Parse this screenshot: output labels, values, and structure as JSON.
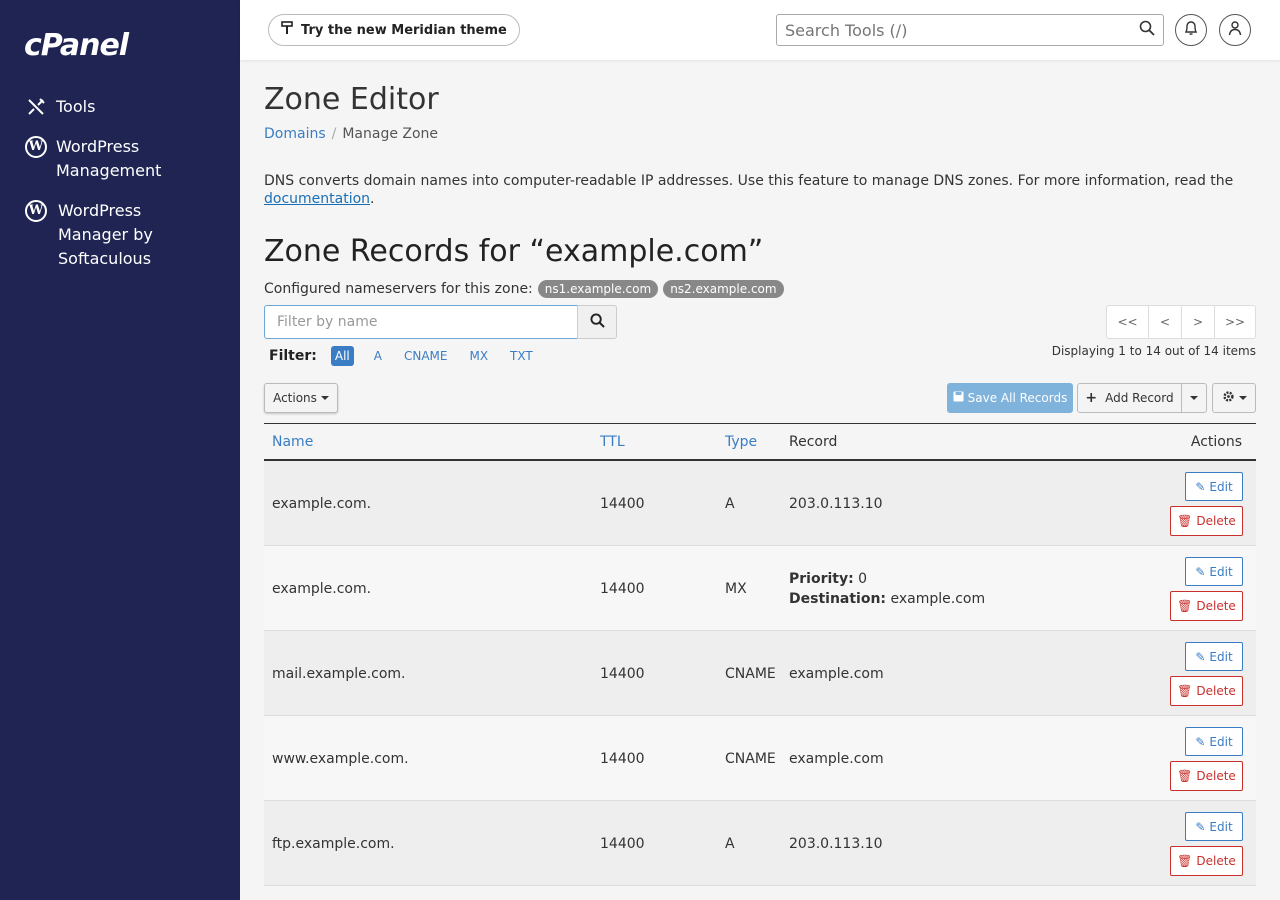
{
  "sidebar": {
    "logo": "cPanel",
    "items": [
      {
        "label": "Tools"
      },
      {
        "label": "WordPress Management"
      },
      {
        "label": "WordPress Manager by Softaculous"
      }
    ]
  },
  "topbar": {
    "theme_label": "Try the new Meridian theme",
    "search_placeholder": "Search Tools (/)"
  },
  "page": {
    "title": "Zone Editor",
    "breadcrumb": [
      "Domains",
      "Manage Zone"
    ],
    "description": "DNS converts domain names into computer-readable IP addresses. Use this feature to manage DNS zones. For more information, read the ",
    "doc_link": "documentation",
    "zone_title": "Zone Records for “example.com”",
    "ns_label": "Configured nameservers for this zone:",
    "nameservers": [
      "ns1.example.com",
      "ns2.example.com"
    ]
  },
  "filter": {
    "placeholder": "Filter by name",
    "label": "Filter:",
    "options": [
      "All",
      "A",
      "CNAME",
      "MX",
      "TXT"
    ],
    "active": "All"
  },
  "pager": {
    "labels": [
      "<<",
      "<",
      ">",
      ">>"
    ],
    "info": "Displaying 1 to 14 out of 14 items"
  },
  "toolbar": {
    "actions": "Actions",
    "save_all": "Save All Records",
    "add_record": "Add Record"
  },
  "table": {
    "headers": {
      "name": "Name",
      "ttl": "TTL",
      "type": "Type",
      "record": "Record",
      "actions": "Actions"
    },
    "edit_label": "Edit",
    "delete_label": "Delete",
    "rows": [
      {
        "name": "example.com.",
        "ttl": "14400",
        "type": "A",
        "record": "203.0.113.10"
      },
      {
        "name": "example.com.",
        "ttl": "14400",
        "type": "MX",
        "priority_label": "Priority:",
        "priority": "0",
        "dest_label": "Destination:",
        "dest": "example.com"
      },
      {
        "name": "mail.example.com.",
        "ttl": "14400",
        "type": "CNAME",
        "record": "example.com"
      },
      {
        "name": "www.example.com.",
        "ttl": "14400",
        "type": "CNAME",
        "record": "example.com"
      },
      {
        "name": "ftp.example.com.",
        "ttl": "14400",
        "type": "A",
        "record": "203.0.113.10"
      }
    ]
  },
  "colors": {
    "sidebar": "#1f2452",
    "link": "#3a7dc4",
    "danger": "#c9302c"
  }
}
